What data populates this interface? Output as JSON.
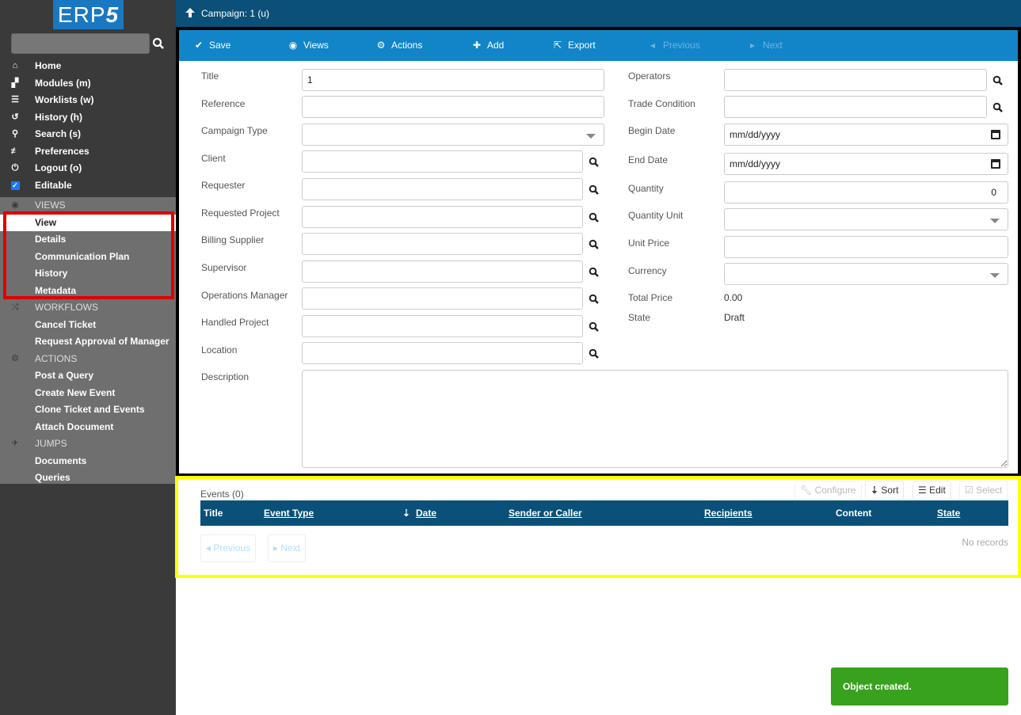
{
  "logo": {
    "text": "ERP",
    "digit": "5"
  },
  "sidebar": {
    "search_placeholder": "",
    "main_items": [
      {
        "label": "Home",
        "icon": "home-icon"
      },
      {
        "label": "Modules (m)",
        "icon": "puzzle-icon"
      },
      {
        "label": "Worklists (w)",
        "icon": "list-icon"
      },
      {
        "label": "History (h)",
        "icon": "history-icon"
      },
      {
        "label": "Search (s)",
        "icon": "search-icon"
      },
      {
        "label": "Preferences",
        "icon": "sliders-icon"
      },
      {
        "label": "Logout (o)",
        "icon": "power-icon"
      },
      {
        "label": "Editable",
        "icon": "checkbox-icon"
      }
    ],
    "sections": {
      "views": {
        "title": "VIEWS",
        "items": [
          "View",
          "Details",
          "Communication Plan",
          "History",
          "Metadata"
        ],
        "active": "View"
      },
      "workflows": {
        "title": "WORKFLOWS",
        "items": [
          "Cancel Ticket",
          "Request Approval of Manager"
        ]
      },
      "actions": {
        "title": "ACTIONS",
        "items": [
          "Post a Query",
          "Create New Event",
          "Clone Ticket and Events",
          "Attach Document"
        ]
      },
      "jumps": {
        "title": "JUMPS",
        "items": [
          "Documents",
          "Queries"
        ]
      }
    }
  },
  "header": {
    "title": "Campaign: 1 (u)"
  },
  "toolbar": {
    "save": "Save",
    "views": "Views",
    "actions": "Actions",
    "add": "Add",
    "export": "Export",
    "previous": "Previous",
    "next": "Next"
  },
  "form": {
    "left": {
      "title": {
        "label": "Title",
        "value": "1"
      },
      "reference": {
        "label": "Reference",
        "value": ""
      },
      "campaign_type": {
        "label": "Campaign Type",
        "value": ""
      },
      "client": {
        "label": "Client",
        "value": ""
      },
      "requester": {
        "label": "Requester",
        "value": ""
      },
      "requested_project": {
        "label": "Requested Project",
        "value": ""
      },
      "billing_supplier": {
        "label": "Billing Supplier",
        "value": ""
      },
      "supervisor": {
        "label": "Supervisor",
        "value": ""
      },
      "operations_manager": {
        "label": "Operations Manager",
        "value": ""
      },
      "handled_project": {
        "label": "Handled Project",
        "value": ""
      },
      "location": {
        "label": "Location",
        "value": ""
      },
      "description": {
        "label": "Description",
        "value": ""
      }
    },
    "right": {
      "operators": {
        "label": "Operators",
        "value": ""
      },
      "trade_condition": {
        "label": "Trade Condition",
        "value": ""
      },
      "begin_date": {
        "label": "Begin Date",
        "placeholder": "mm/dd/yyyy"
      },
      "end_date": {
        "label": "End Date",
        "placeholder": "mm/dd/yyyy"
      },
      "quantity": {
        "label": "Quantity",
        "value": "0"
      },
      "quantity_unit": {
        "label": "Quantity Unit",
        "value": ""
      },
      "unit_price": {
        "label": "Unit Price",
        "value": ""
      },
      "currency": {
        "label": "Currency",
        "value": ""
      },
      "total_price": {
        "label": "Total Price",
        "value": "0.00"
      },
      "state": {
        "label": "State",
        "value": "Draft"
      }
    }
  },
  "events": {
    "title": "Events (0)",
    "buttons": {
      "configure": "Configure",
      "sort": "Sort",
      "edit": "Edit",
      "select": "Select"
    },
    "columns": [
      "Title",
      "Event Type",
      "Date",
      "Sender or Caller",
      "Recipients",
      "Content",
      "State"
    ],
    "empty": "No records",
    "previous": "Previous",
    "next": "Next"
  },
  "toast": {
    "message": "Object created.",
    "color": "#38a11e"
  },
  "colors": {
    "header": "#0a5078",
    "toolbar": "#1285c8",
    "sidebar": "#3a3a3a",
    "logo": "#1a78c2"
  }
}
